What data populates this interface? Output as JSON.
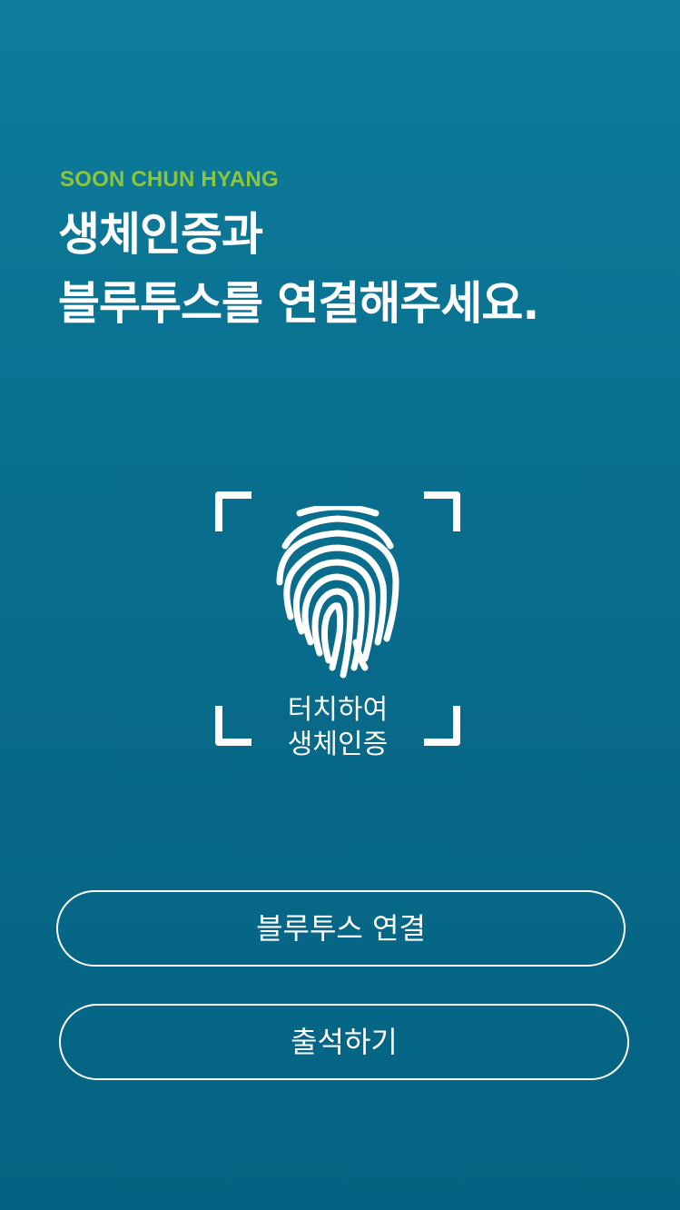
{
  "header": {
    "brand": "SOON CHUN HYANG",
    "headline_line1": "생체인증과",
    "headline_line2": "블루투스를 연결해주세요."
  },
  "biometric": {
    "icon": "fingerprint-icon",
    "label_line1": "터치하여",
    "label_line2": "생체인증"
  },
  "actions": {
    "bluetooth_label": "블루투스 연결",
    "attendance_label": "출석하기"
  },
  "colors": {
    "brand_accent": "#8cc63f",
    "background_top": "#0d7c9b",
    "background_bottom": "#046382",
    "foreground": "#ffffff"
  }
}
